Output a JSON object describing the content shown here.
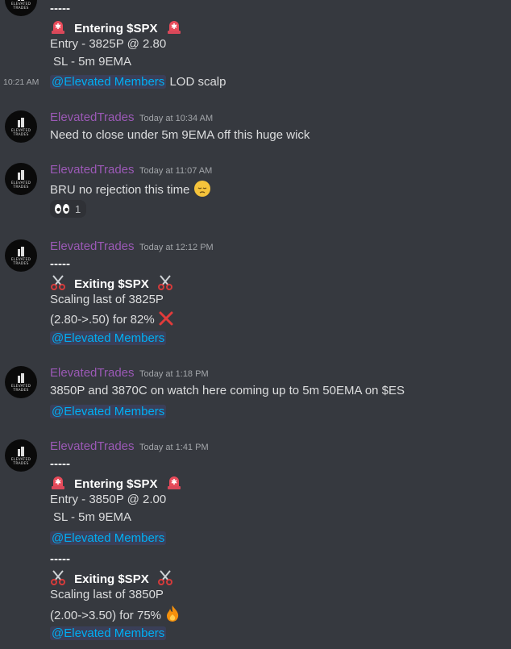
{
  "brand": {
    "mention_color": "#00aff4",
    "name_color": "#9b59b6",
    "bg": "#36393f"
  },
  "avatar_label": "ELEVATED TRADES",
  "msg0": {
    "dashes": "-----",
    "title": "Entering $SPX",
    "entry": "Entry - 3825P @ 2.80",
    "sl": "SL - 5m 9EMA"
  },
  "msg0b": {
    "hover_time": "10:21 AM",
    "mention": "@Elevated Members",
    "text": "LOD scalp"
  },
  "msg1": {
    "author": "ElevatedTrades",
    "time": "Today at 10:34 AM",
    "text": "Need to close under 5m 9EMA off this huge wick"
  },
  "msg2": {
    "author": "ElevatedTrades",
    "time": "Today at 11:07 AM",
    "text": "BRU no rejection this time",
    "emoji": "pensive-face-icon",
    "reaction_emoji": "eyes-icon",
    "reaction_count": "1"
  },
  "msg3": {
    "author": "ElevatedTrades",
    "time": "Today at 12:12 PM",
    "dashes": "-----",
    "title": "Exiting $SPX",
    "line1": "Scaling last of 3825P",
    "line2": "(2.80->.50) for 82%",
    "mention": "@Elevated Members"
  },
  "msg4": {
    "author": "ElevatedTrades",
    "time": "Today at 1:18 PM",
    "text": "3850P and 3870C on watch here coming up to 5m 50EMA on $ES",
    "mention": "@Elevated Members"
  },
  "msg5": {
    "author": "ElevatedTrades",
    "time": "Today at 1:41 PM",
    "dashes": "-----",
    "title": "Entering $SPX",
    "entry": "Entry - 3850P @ 2.00",
    "sl": "SL - 5m 9EMA",
    "mention": "@Elevated Members"
  },
  "msg6": {
    "dashes": "-----",
    "title": "Exiting $SPX",
    "line1": "Scaling last of 3850P",
    "line2": "(2.00->3.50) for 75%",
    "mention": "@Elevated Members"
  }
}
